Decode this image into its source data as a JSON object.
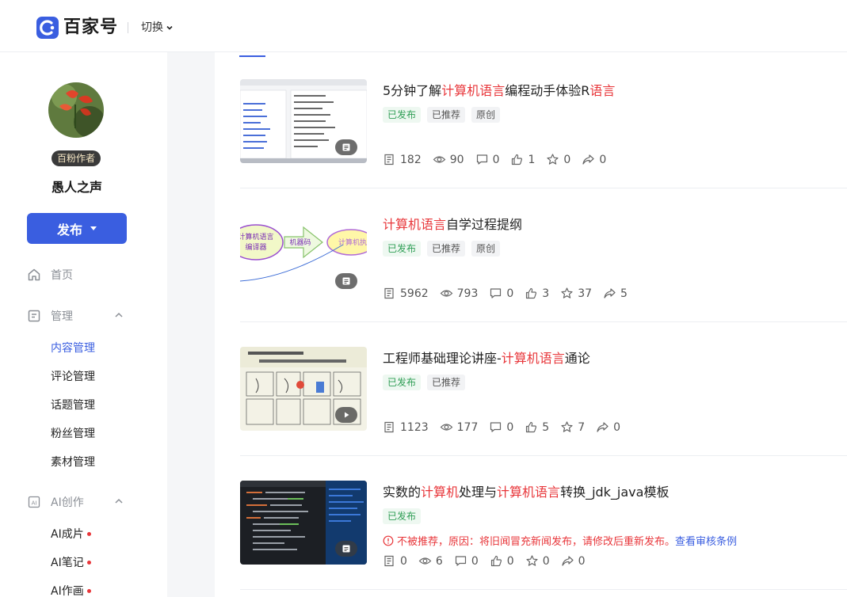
{
  "header": {
    "logo_text": "百家号",
    "switch_label": "切换"
  },
  "profile": {
    "badge": "百粉作者",
    "name": "愚人之声",
    "publish_label": "发布"
  },
  "nav": {
    "home": "首页",
    "manage": "管理",
    "manage_items": [
      "内容管理",
      "评论管理",
      "话题管理",
      "粉丝管理",
      "素材管理"
    ],
    "ai": "AI创作",
    "ai_items": [
      "AI成片",
      "AI笔记",
      "AI作画"
    ]
  },
  "articles": [
    {
      "title_parts": [
        {
          "text": "5分钟了解",
          "hl": false
        },
        {
          "text": "计算机语言",
          "hl": true
        },
        {
          "text": "编程动手体验R",
          "hl": false
        },
        {
          "text": "语言",
          "hl": true
        }
      ],
      "tags": [
        "已发布",
        "已推荐",
        "原创"
      ],
      "stats": {
        "reads": "182",
        "views": "90",
        "comments": "0",
        "likes": "1",
        "favorites": "0",
        "shares": "0"
      },
      "media": "doc-icon"
    },
    {
      "title_parts": [
        {
          "text": "计算机语言",
          "hl": true
        },
        {
          "text": "自学过程提纲",
          "hl": false
        }
      ],
      "tags": [
        "已发布",
        "已推荐",
        "原创"
      ],
      "stats": {
        "reads": "5962",
        "views": "793",
        "comments": "0",
        "likes": "3",
        "favorites": "37",
        "shares": "5"
      },
      "media": "doc-icon",
      "thumb_text": [
        "计算机语言",
        "编译器",
        "机器码",
        "计算机执"
      ]
    },
    {
      "title_parts": [
        {
          "text": "工程师基础理论讲座-",
          "hl": false
        },
        {
          "text": "计算机语言",
          "hl": true
        },
        {
          "text": "通论",
          "hl": false
        }
      ],
      "tags": [
        "已发布",
        "已推荐"
      ],
      "stats": {
        "reads": "1123",
        "views": "177",
        "comments": "0",
        "likes": "5",
        "favorites": "7",
        "shares": "0"
      },
      "media": "play-icon"
    },
    {
      "title_parts": [
        {
          "text": "实数的",
          "hl": false
        },
        {
          "text": "计算机",
          "hl": true
        },
        {
          "text": "处理与",
          "hl": false
        },
        {
          "text": "计算机语言",
          "hl": true
        },
        {
          "text": "转换_jdk_java模板",
          "hl": false
        }
      ],
      "tags": [
        "已发布"
      ],
      "warning": "不被推荐，原因：将旧闻冒充新闻发布，请修改后重新发布。",
      "warning_link": "查看审核条例",
      "stats": {
        "reads": "0",
        "views": "6",
        "comments": "0",
        "likes": "0",
        "favorites": "0",
        "shares": "0"
      },
      "media": "doc-icon"
    }
  ],
  "colors": {
    "accent": "#3a5ee0",
    "highlight": "#e8363a",
    "published_green": "#2f9e55"
  }
}
